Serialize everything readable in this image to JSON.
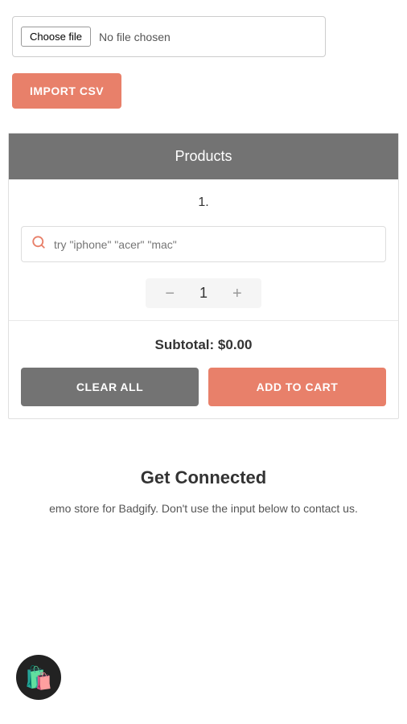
{
  "file_section": {
    "choose_file_label": "Choose file",
    "no_file_label": "No file chosen"
  },
  "import_button": {
    "label": "IMPORT CSV"
  },
  "products_section": {
    "header": "Products",
    "product_number": "1.",
    "search_placeholder": "try \"iphone\" \"acer\" \"mac\"",
    "quantity": "1",
    "subtotal_label": "Subtotal:",
    "subtotal_value": "$0.00"
  },
  "action_buttons": {
    "clear_label": "CLEAR ALL",
    "add_to_cart_label": "ADD TO CART"
  },
  "footer": {
    "title": "Get Connected",
    "description": "emo store for Badgify. Don't use the input below to contact us."
  },
  "icons": {
    "search": "🔍",
    "minus": "−",
    "plus": "+",
    "shopify": "🛍"
  }
}
